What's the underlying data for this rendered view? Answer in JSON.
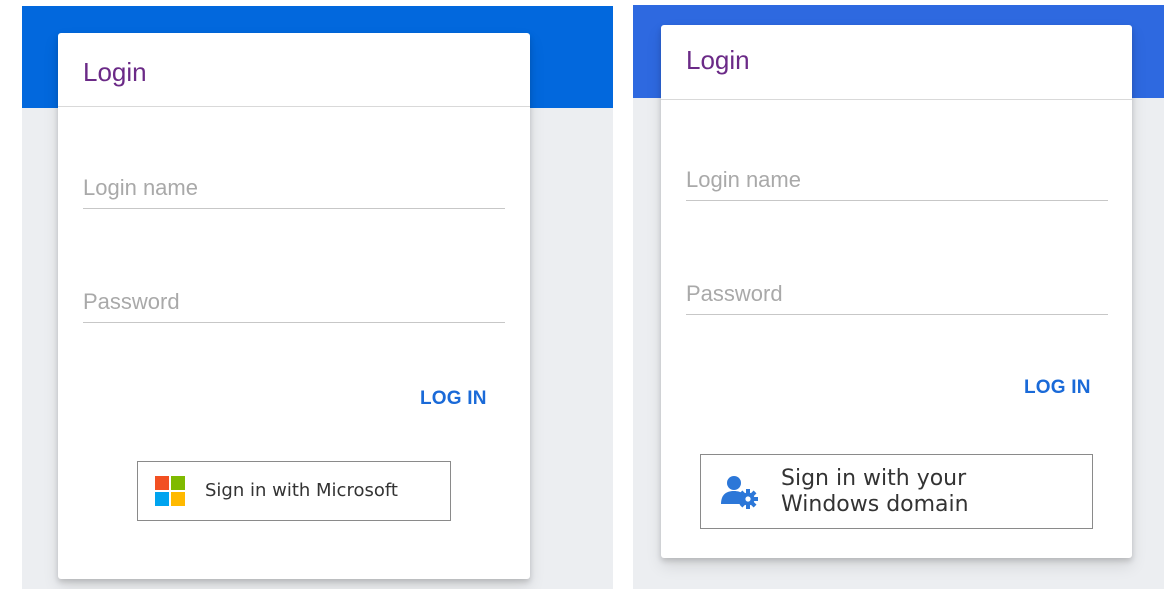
{
  "colors": {
    "panel1_band": "#0268dd",
    "panel2_band": "#2e69e0",
    "title": "#6b2a87",
    "accent_link": "#1a6ad8",
    "ms_red": "#f25022",
    "ms_green": "#7fba00",
    "ms_blue": "#00a4ef",
    "ms_yellow": "#ffb900",
    "domain_icon": "#2c77d8"
  },
  "panel_microsoft": {
    "title": "Login",
    "login_name_placeholder": "Login name",
    "password_placeholder": "Password",
    "login_button": "LOG IN",
    "sso_button_label": "Sign in with Microsoft",
    "sso_icon": "microsoft-logo-icon"
  },
  "panel_windows": {
    "title": "Login",
    "login_name_placeholder": "Login name",
    "password_placeholder": "Password",
    "login_button": "LOG IN",
    "sso_button_label": "Sign in with your Windows domain",
    "sso_icon": "user-gear-icon"
  }
}
